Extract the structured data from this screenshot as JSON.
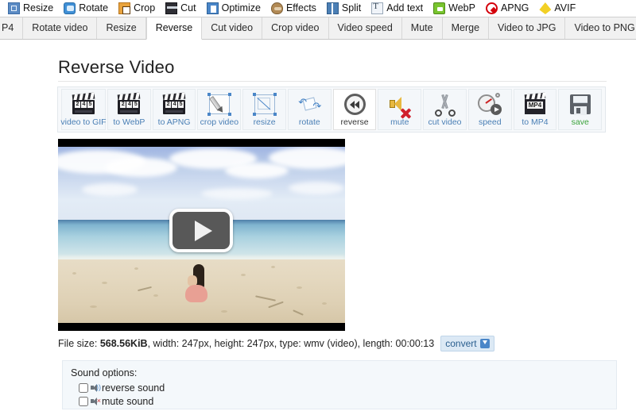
{
  "topbar": {
    "items": [
      {
        "label": "Resize",
        "icon": "resize-icon"
      },
      {
        "label": "Rotate",
        "icon": "rotate-icon"
      },
      {
        "label": "Crop",
        "icon": "crop-icon"
      },
      {
        "label": "Cut",
        "icon": "cut-icon"
      },
      {
        "label": "Optimize",
        "icon": "optimize-icon"
      },
      {
        "label": "Effects",
        "icon": "effects-icon"
      },
      {
        "label": "Split",
        "icon": "split-icon"
      },
      {
        "label": "Add text",
        "icon": "add-text-icon"
      },
      {
        "label": "WebP",
        "icon": "webp-icon"
      },
      {
        "label": "APNG",
        "icon": "apng-icon"
      },
      {
        "label": "AVIF",
        "icon": "avif-icon"
      }
    ]
  },
  "tabs": {
    "items": [
      {
        "label": "P4",
        "active": false,
        "partial": true
      },
      {
        "label": "Rotate video",
        "active": false
      },
      {
        "label": "Resize",
        "active": false
      },
      {
        "label": "Reverse",
        "active": true
      },
      {
        "label": "Cut video",
        "active": false
      },
      {
        "label": "Crop video",
        "active": false
      },
      {
        "label": "Video speed",
        "active": false
      },
      {
        "label": "Mute",
        "active": false
      },
      {
        "label": "Merge",
        "active": false
      },
      {
        "label": "Video to JPG",
        "active": false
      },
      {
        "label": "Video to PNG",
        "active": false
      }
    ]
  },
  "page": {
    "title": "Reverse Video"
  },
  "tool_icons": [
    {
      "label": "video to GIF",
      "icon": "clapperboard-icon",
      "selected": false
    },
    {
      "label": "to WebP",
      "icon": "clapperboard-icon",
      "selected": false
    },
    {
      "label": "to APNG",
      "icon": "clapperboard-icon",
      "selected": false
    },
    {
      "label": "crop video",
      "icon": "crop-pen-icon",
      "selected": false
    },
    {
      "label": "resize",
      "icon": "resize-handles-icon",
      "selected": false
    },
    {
      "label": "rotate",
      "icon": "rotate-arrows-icon",
      "selected": false
    },
    {
      "label": "reverse",
      "icon": "rewind-icon",
      "selected": true
    },
    {
      "label": "mute",
      "icon": "speaker-mute-icon",
      "selected": false
    },
    {
      "label": "cut video",
      "icon": "scissors-icon",
      "selected": false
    },
    {
      "label": "speed",
      "icon": "speedometer-icon",
      "selected": false
    },
    {
      "label": "to MP4",
      "icon": "mp4-clapperboard-icon",
      "selected": false
    },
    {
      "label": "save",
      "icon": "floppy-disk-icon",
      "selected": false,
      "green": true
    }
  ],
  "video": {
    "play_button": "play-icon"
  },
  "file_info": {
    "label": "File size:",
    "size": "568.56KiB",
    "rest": ", width: 247px, height: 247px, type: wmv (video), length: 00:00:13",
    "convert_label": "convert"
  },
  "sound_options": {
    "heading": "Sound options:",
    "options": [
      {
        "label": "reverse sound",
        "checked": false,
        "icon": "speaker-icon"
      },
      {
        "label": "mute sound",
        "checked": false,
        "icon": "speaker-mute-icon"
      }
    ]
  },
  "colors": {
    "accent": "#4a7fb5",
    "save_green": "#3ba33b",
    "panel_bg": "#f4f8fb",
    "tab_bg": "#f1f1f1"
  }
}
